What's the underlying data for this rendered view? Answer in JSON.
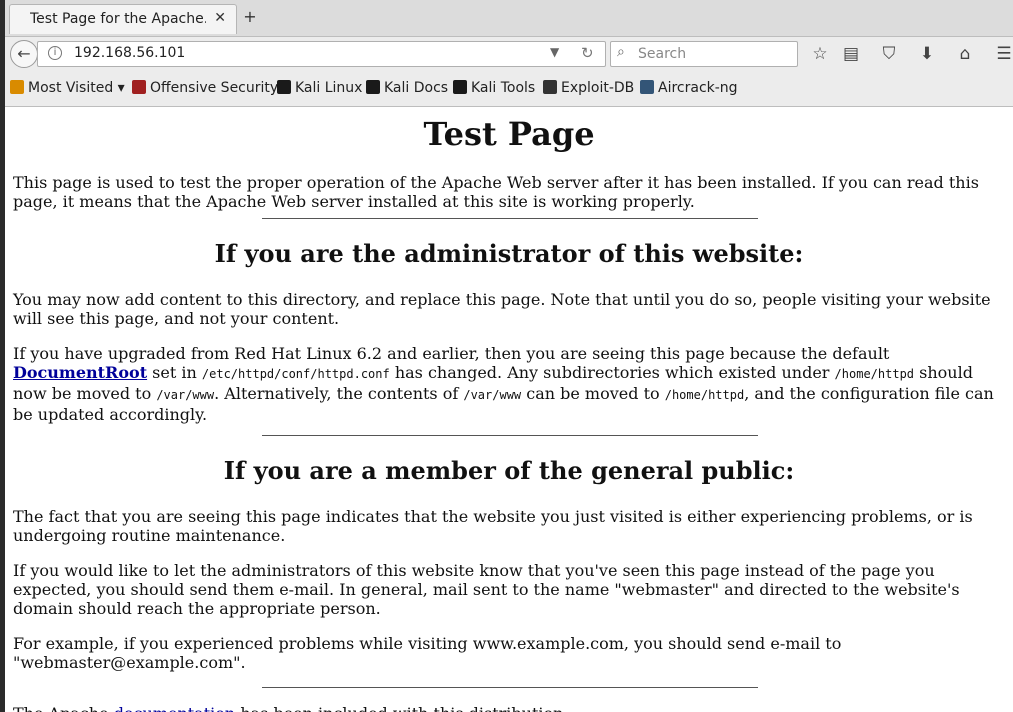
{
  "tab": {
    "title": "Test Page for the Apache...",
    "close": "✕",
    "new_tab": "+"
  },
  "nav": {
    "back": "←",
    "info": "i",
    "url": "192.168.56.101",
    "dropdown": "▼",
    "reload": "↻",
    "search_placeholder": "Search"
  },
  "toolbar_icons": [
    "star-icon",
    "reading-list-icon",
    "pocket-icon",
    "download-icon",
    "home-icon",
    "menu-icon"
  ],
  "bookmarks": [
    {
      "label": "Most Visited ▾",
      "color": "#d98b00"
    },
    {
      "label": "Offensive Security",
      "color": "#a02020"
    },
    {
      "label": "Kali Linux",
      "color": "#1a1a1a"
    },
    {
      "label": "Kali Docs",
      "color": "#1a1a1a"
    },
    {
      "label": "Kali Tools",
      "color": "#1a1a1a"
    },
    {
      "label": "Exploit-DB",
      "color": "#333333"
    },
    {
      "label": "Aircrack-ng",
      "color": "#335577"
    }
  ],
  "page": {
    "title": "Test Page",
    "intro": "This page is used to test the proper operation of the Apache Web server after it has been installed. If you can read this page, it means that the Apache Web server installed at this site is working properly.",
    "admin_heading": "If you are the administrator of this website:",
    "admin_p1": "You may now add content to this directory, and replace this page. Note that until you do so, people visiting your website will see this page, and not your content.",
    "admin_p2_a": "If you have upgraded from Red Hat Linux 6.2 and earlier, then you are seeing this page because the default ",
    "admin_p2_link": "DocumentRoot",
    "admin_p2_b": " set in ",
    "admin_p2_path1": "/etc/httpd/conf/httpd.conf",
    "admin_p2_c": " has changed. Any subdirectories which existed under ",
    "admin_p2_path2": "/home/httpd",
    "admin_p2_d": " should now be moved to ",
    "admin_p2_path3": "/var/www",
    "admin_p2_e": ". Alternatively, the contents of ",
    "admin_p2_path4": "/var/www",
    "admin_p2_f": " can be moved to ",
    "admin_p2_path5": "/home/httpd",
    "admin_p2_g": ", and the configuration file can be updated accordingly.",
    "public_heading": "If you are a member of the general public:",
    "public_p1": "The fact that you are seeing this page indicates that the website you just visited is either experiencing problems, or is undergoing routine maintenance.",
    "public_p2": "If you would like to let the administrators of this website know that you've seen this page instead of the page you expected, you should send them e-mail. In general, mail sent to the name \"webmaster\" and directed to the website's domain should reach the appropriate person.",
    "public_p3": "For example, if you experienced problems while visiting www.example.com, you should send e-mail to \"webmaster@example.com\".",
    "footer_a": "The Apache ",
    "footer_link": "documentation",
    "footer_b": " has been included with this distribution."
  }
}
